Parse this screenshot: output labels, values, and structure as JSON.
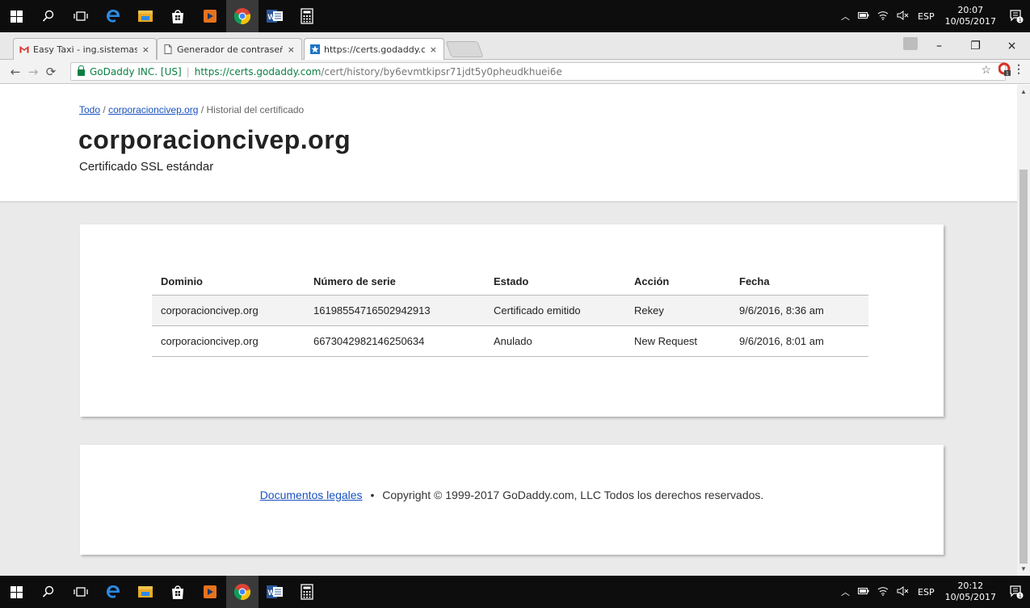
{
  "taskbar_top": {
    "tray_lang": "ESP",
    "time": "20:07",
    "date": "10/05/2017",
    "notifications": "1"
  },
  "taskbar_bottom": {
    "tray_lang": "ESP",
    "time": "20:12",
    "date": "10/05/2017",
    "notifications": "1"
  },
  "tabs": [
    {
      "title": "Easy Taxi - ing.sistemasju",
      "close": "×",
      "icon": "gmail-icon"
    },
    {
      "title": "Generador de contraseña",
      "close": "×",
      "icon": "page-icon"
    },
    {
      "title": "https://certs.godaddy.co",
      "close": "×",
      "icon": "godaddy-icon"
    }
  ],
  "window_controls": {
    "minimize": "–",
    "restore": "❐",
    "close": "×"
  },
  "address_bar": {
    "ev_name": "GoDaddy INC. [US]",
    "url_host": "https://certs.godaddy.com",
    "url_path": "/cert/history/by6evmtkipsr71jdt5y0pheudkhuei6e"
  },
  "breadcrumb": {
    "all": "Todo",
    "domain": "corporacioncivep.org",
    "current": "Historial del certificado",
    "separator": "/"
  },
  "page": {
    "title": "corporacioncivep.org",
    "subtitle": "Certificado SSL estándar"
  },
  "history_table": {
    "headers": [
      "Dominio",
      "Número de serie",
      "Estado",
      "Acción",
      "Fecha"
    ],
    "rows": [
      [
        "corporacioncivep.org",
        "16198554716502942913",
        "Certificado emitido",
        "Rekey",
        "9/6/2016, 8:36 am"
      ],
      [
        "corporacioncivep.org",
        "6673042982146250634",
        "Anulado",
        "New Request",
        "9/6/2016, 8:01 am"
      ]
    ]
  },
  "footer": {
    "legal_link": "Documentos legales",
    "bullet": "•",
    "copyright": "Copyright © 1999-2017 GoDaddy.com, LLC Todos los derechos reservados."
  },
  "colors": {
    "link": "#1a52bf",
    "secure_green": "#0b8043",
    "page_background": "#eaeaea",
    "taskbar": "#0d0d0d"
  }
}
